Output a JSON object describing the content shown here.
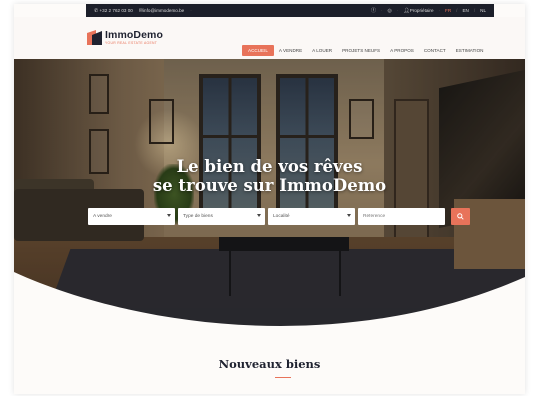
{
  "colors": {
    "accent": "#e8735a",
    "dark": "#1f2230",
    "topbar": "#1c1f2a"
  },
  "topbar": {
    "phone": "+32 2 762 03 00",
    "email": "info@immodemo.be",
    "owner_link": "Propriétaire",
    "languages": [
      "FR",
      "EN",
      "NL"
    ],
    "active_language": "FR"
  },
  "logo": {
    "name": "ImmoDemo",
    "tagline": "YOUR REAL ESTATE AGENT"
  },
  "nav": {
    "items": [
      {
        "label": "ACCUEIL",
        "active": true
      },
      {
        "label": "A VENDRE",
        "active": false
      },
      {
        "label": "A LOUER",
        "active": false
      },
      {
        "label": "PROJETS NEUFS",
        "active": false
      },
      {
        "label": "A PROPOS",
        "active": false
      },
      {
        "label": "CONTACT",
        "active": false
      },
      {
        "label": "ESTIMATION",
        "active": false
      }
    ]
  },
  "hero": {
    "title_line1": "Le bien de vos rêves",
    "title_line2": "se trouve sur ImmoDemo"
  },
  "search": {
    "transaction": "A vendre",
    "property_type": "Type de biens",
    "locality": "Localité",
    "reference_placeholder": "Référence",
    "submit_icon": "search-icon"
  },
  "section": {
    "title": "Nouveaux biens"
  }
}
